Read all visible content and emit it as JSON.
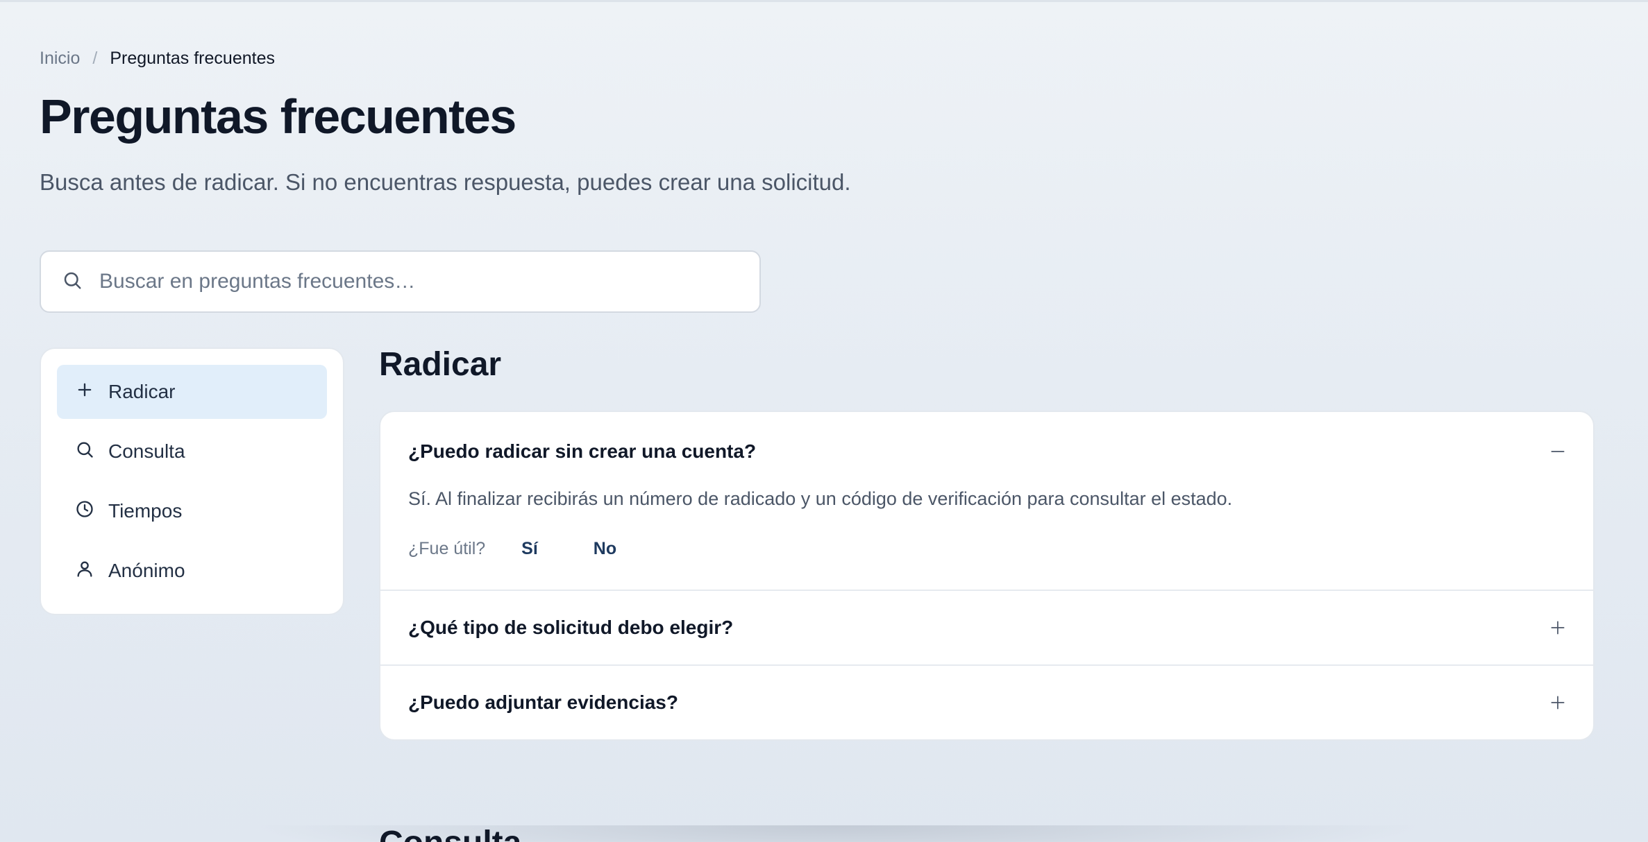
{
  "breadcrumb": {
    "home": "Inicio",
    "separator": "/",
    "current": "Preguntas frecuentes"
  },
  "header": {
    "title": "Preguntas frecuentes",
    "subtitle": "Busca antes de radicar. Si no encuentras respuesta, puedes crear una solicitud."
  },
  "search": {
    "placeholder": "Buscar en preguntas frecuentes…",
    "value": "",
    "icon": "search-icon"
  },
  "sidebar": {
    "items": [
      {
        "label": "Radicar",
        "icon": "plus-icon",
        "active": true
      },
      {
        "label": "Consulta",
        "icon": "search-icon",
        "active": false
      },
      {
        "label": "Tiempos",
        "icon": "clock-icon",
        "active": false
      },
      {
        "label": "Anónimo",
        "icon": "user-icon",
        "active": false
      }
    ]
  },
  "main": {
    "section_title": "Radicar",
    "faqs": [
      {
        "question": "¿Puedo radicar sin crear una cuenta?",
        "answer": "Sí. Al finalizar recibirás un número de radicado y un código de verificación para consultar el estado.",
        "expanded": true,
        "toggle_icon": "minus-icon"
      },
      {
        "question": "¿Qué tipo de solicitud debo elegir?",
        "expanded": false,
        "toggle_icon": "plus-icon"
      },
      {
        "question": "¿Puedo adjuntar evidencias?",
        "expanded": false,
        "toggle_icon": "plus-icon"
      }
    ],
    "feedback": {
      "label": "¿Fue útil?",
      "yes": "Sí",
      "no": "No"
    },
    "next_section_title": "Consulta"
  },
  "colors": {
    "background": "#e6ecf3",
    "active_item": "#e1eefa",
    "heading": "#101828",
    "muted_text": "#6b7788",
    "feedback_button": "#1e3a5f"
  }
}
